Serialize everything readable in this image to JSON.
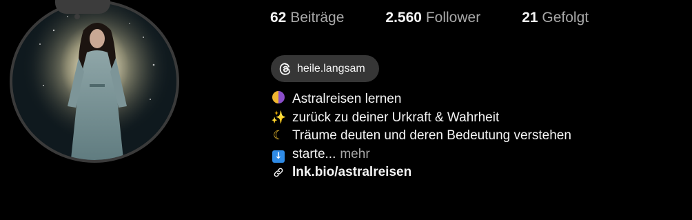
{
  "stats": {
    "posts": {
      "count": "62",
      "label": "Beiträge"
    },
    "followers": {
      "count": "2.560",
      "label": "Follower"
    },
    "following": {
      "count": "21",
      "label": "Gefolgt"
    }
  },
  "threads": {
    "handle": "heile.langsam",
    "icon": "threads-icon"
  },
  "bio": {
    "lines": [
      {
        "icon": "half-moon-icon",
        "text": "Astralreisen lernen"
      },
      {
        "icon": "sparkles-icon",
        "text": "zurück zu deiner Urkraft & Wahrheit"
      },
      {
        "icon": "crescent-moon-icon",
        "text": "Träume deuten und deren Bedeutung verstehen"
      },
      {
        "icon": "down-arrow-icon",
        "text": "starte..."
      }
    ],
    "more_label": "mehr",
    "link": {
      "icon": "link-icon",
      "text": "lnk.bio/astralreisen"
    }
  },
  "colors": {
    "background": "#000000",
    "text": "#f5f5f5",
    "muted": "#a8a8a8",
    "chip": "#363636"
  }
}
